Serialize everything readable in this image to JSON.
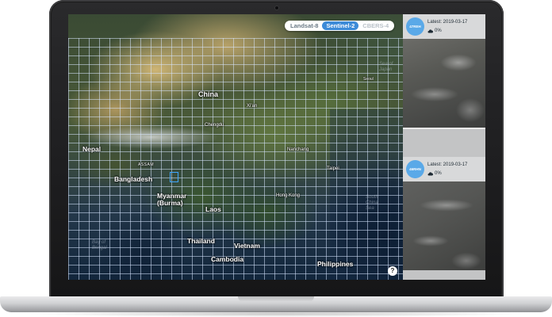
{
  "toggle": {
    "options": [
      "Landsat-8",
      "Sentinel-2",
      "CBERS-4"
    ],
    "selected": "Sentinel-2"
  },
  "map": {
    "labels": {
      "china": "China",
      "nepal": "Nepal",
      "bangladesh": "Bangladesh",
      "myanmar": "Myanmar\n(Burma)",
      "laos": "Laos",
      "thailand": "Thailand",
      "vietnam": "Vietnam",
      "cambodia": "Cambodia",
      "philippines": "Philippines",
      "hong_kong": "Hong Kong",
      "taipei": "Taipei",
      "nanchang": "Nanchang",
      "chengdu": "Chengdu",
      "xian": "Xi'an",
      "seoul": "Seoul",
      "assam": "ASSAM",
      "bay_of_bengal": "Bay of\nBengal",
      "south_china_sea": "South\nChina\nSea",
      "sea_of_japan": "Sea of\nJapan"
    },
    "help_label": "?"
  },
  "scenes": [
    {
      "tile_id": "47REH",
      "date_label": "Latest: 2019-03-17",
      "cloud_cover": "0%"
    },
    {
      "tile_id": "46RHN",
      "date_label": "Latest: 2019-03-17",
      "cloud_cover": "0%"
    }
  ],
  "colors": {
    "active_toggle": "#3d8bd8",
    "badge": "#5aa9e8",
    "grid": "#d7e6ff",
    "highlight_tile": "#3fa7ff"
  }
}
